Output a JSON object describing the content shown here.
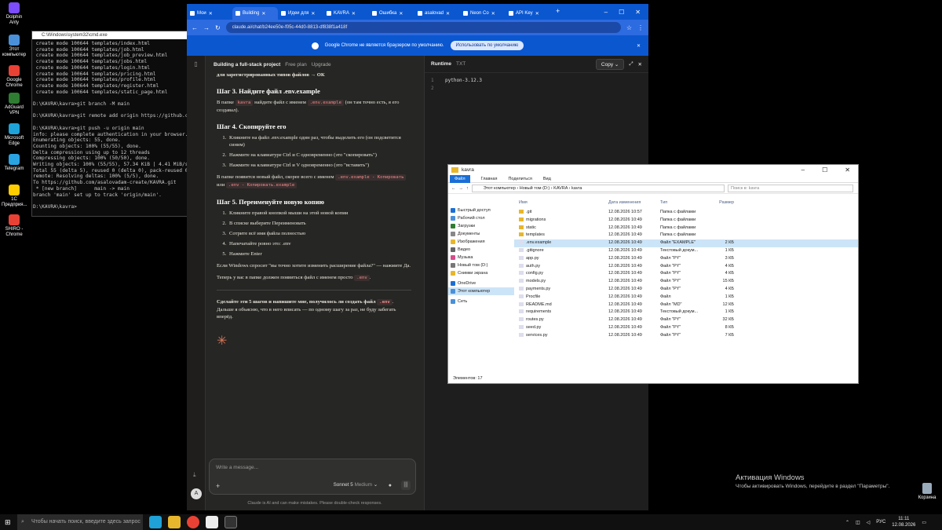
{
  "desktop": {
    "icons": [
      {
        "label": "Dolphin Anty",
        "color": "#7b4dff"
      },
      {
        "label": "Этот компьютер",
        "color": "#4a90d9"
      },
      {
        "label": "Google Chrome",
        "color": "#e94235"
      },
      {
        "label": "AdGuard VPN",
        "color": "#2e7d32"
      },
      {
        "label": "Microsoft Edge",
        "color": "#1fa2d8"
      },
      {
        "label": "Telegram",
        "color": "#2aa3e3"
      },
      {
        "label": "1С Предприя...",
        "color": "#ffcc00"
      },
      {
        "label": "SHIRO - Chrome",
        "color": "#e94235"
      }
    ],
    "recycle_bin": "Корзина"
  },
  "cmd": {
    "title": "C:\\Windows\\system32\\cmd.exe",
    "lines": [
      " create mode 100644 templates/index.html",
      " create mode 100644 templates/job.html",
      " create mode 100644 templates/job_preview.html",
      " create mode 100644 templates/jobs.html",
      " create mode 100644 templates/login.html",
      " create mode 100644 templates/pricing.html",
      " create mode 100644 templates/profile.html",
      " create mode 100644 templates/register.html",
      " create mode 100644 templates/static_page.html",
      "",
      "D:\\KAVRA\\kavra>git branch -M main",
      "",
      "D:\\KAVRA\\kavra>git remote add origin https://github.c",
      "",
      "D:\\KAVRA\\kavra>git push -u origin main",
      "info: please complete authentication in your browser.",
      "Enumerating objects: 55, done.",
      "Counting objects: 100% (55/55), done.",
      "Delta compression using up to 12 threads",
      "Compressing objects: 100% (50/50), done.",
      "Writing objects: 100% (55/55), 57.34 KiB | 4.41 MiB/s",
      "Total 55 (delta 5), reused 0 (delta 0), pack-reused 0",
      "remote: Resolving deltas: 100% (5/5), done.",
      "To https://github.com/asalovadam-create/KAVRA.git",
      " * [new branch]      main -> main",
      "branch 'main' set up to track 'origin/main'.",
      "",
      "D:\\KAVRA\\kavra>"
    ]
  },
  "chrome": {
    "tabs": [
      "Мои",
      "Building",
      "Идеи для",
      "KAVRA",
      "Ошибка",
      "asalovad",
      "Neon Co",
      "API Key"
    ],
    "url": "claude.ai/chat/b24ee50e-f05c-44d0-8813-df838f1a418f",
    "infobar_text": "Google Chrome не является браузером по умолчанию.",
    "infobar_button": "Использовать по умолчанию"
  },
  "claude": {
    "chat_title": "Building a full-stack project",
    "plan": "Free plan",
    "upgrade": "Upgrade",
    "top_cut": "для зарегистрированных типов файлов → ОК",
    "step3_title": "Шаг 3. Найдите файл .env.example",
    "step3_a": "В папке",
    "step3_code1": "kavra",
    "step3_b": "найдите файл с именем",
    "step3_code2": ".env.example",
    "step3_c": "(он там точно есть, я его создавал).",
    "step4_title": "Шаг 4. Скопируйте его",
    "step4_items": [
      "Кликните на файл .env.example один раз, чтобы выделить его (он подсветится синим)",
      "Нажмите на клавиатуре Ctrl и C одновременно (это \"скопировать\")",
      "Нажмите на клавиатуре Ctrl и V одновременно (это \"вставить\")"
    ],
    "step4_after": "В папке появится новый файл, скорее всего с именем",
    "step4_code1": ".env.example - Копировать",
    "step4_or": "или",
    "step4_code2": ".env - Копировать.example",
    "step5_title": "Шаг 5. Переименуйте новую копию",
    "step5_items": [
      "Кликните правой кнопкой мыши на этой новой копии",
      "В списке выберите Переименовать",
      "Сотрите всё имя файла полностью",
      "Напечатайте ровно это: .env",
      "Нажмите Enter"
    ],
    "step5_note": "Если Windows спросит \"вы точно хотите изменить расширение файла?\" — нажмите Да.",
    "step5_result_a": "Теперь у вас в папке должен появиться файл с именем просто",
    "step5_result_code": ".env",
    "final_a": "Сделайте эти 5 шагов и напишите мне, получилось ли создать файл",
    "final_code": ".env",
    "final_b": ". Дальше я объясню, что в него вписать — по одному шагу за раз, не буду забегать вперёд.",
    "placeholder": "Write a message...",
    "model": "Sonnet 5",
    "model_mode": "Medium",
    "disclaimer": "Claude is AI and can make mistakes. Please double-check responses.",
    "avatar": "A"
  },
  "artifact": {
    "title": "Runtime",
    "type": "TXT",
    "copy": "Copy",
    "lines": [
      "python-3.12.3",
      ""
    ]
  },
  "explorer": {
    "title": "kavra",
    "ribbon": [
      "Файл",
      "Главная",
      "Поделиться",
      "Вид"
    ],
    "path": [
      "Этот компьютер",
      "Новый том (D:)",
      "KAVRA",
      "kavra"
    ],
    "search_placeholder": "Поиск в: kavra",
    "nav": [
      "Быстрый доступ",
      "Рабочий стол",
      "Загрузки",
      "Документы",
      "Изображения",
      "Видео",
      "Музыка",
      "Новый том (D:)",
      "Снимки экрана",
      "OneDrive",
      "Этот компьютер",
      "Сеть"
    ],
    "columns": [
      "Имя",
      "Дата изменения",
      "Тип",
      "Размер"
    ],
    "files": [
      {
        "name": ".git",
        "date": "12.08.2026 10:57",
        "type": "Папка с файлами",
        "size": "",
        "folder": true
      },
      {
        "name": "migrations",
        "date": "12.08.2026 10:49",
        "type": "Папка с файлами",
        "size": "",
        "folder": true
      },
      {
        "name": "static",
        "date": "12.08.2026 10:49",
        "type": "Папка с файлами",
        "size": "",
        "folder": true
      },
      {
        "name": "templates",
        "date": "12.08.2026 10:49",
        "type": "Папка с файлами",
        "size": "",
        "folder": true
      },
      {
        "name": ".env.example",
        "date": "12.08.2026 10:49",
        "type": "Файл \"EXAMPLE\"",
        "size": "2 КБ",
        "folder": false
      },
      {
        "name": ".gitignore",
        "date": "12.08.2026 10:49",
        "type": "Текстовый докум...",
        "size": "1 КБ",
        "folder": false
      },
      {
        "name": "app.py",
        "date": "12.08.2026 10:49",
        "type": "Файл \"PY\"",
        "size": "3 КБ",
        "folder": false
      },
      {
        "name": "auth.py",
        "date": "12.08.2026 10:49",
        "type": "Файл \"PY\"",
        "size": "4 КБ",
        "folder": false
      },
      {
        "name": "config.py",
        "date": "12.08.2026 10:49",
        "type": "Файл \"PY\"",
        "size": "4 КБ",
        "folder": false
      },
      {
        "name": "models.py",
        "date": "12.08.2026 10:49",
        "type": "Файл \"PY\"",
        "size": "15 КБ",
        "folder": false
      },
      {
        "name": "payments.py",
        "date": "12.08.2026 10:49",
        "type": "Файл \"PY\"",
        "size": "4 КБ",
        "folder": false
      },
      {
        "name": "Procfile",
        "date": "12.08.2026 10:49",
        "type": "Файл",
        "size": "1 КБ",
        "folder": false
      },
      {
        "name": "README.md",
        "date": "12.08.2026 10:49",
        "type": "Файл \"MD\"",
        "size": "12 КБ",
        "folder": false
      },
      {
        "name": "requirements",
        "date": "12.08.2026 10:49",
        "type": "Текстовый докум...",
        "size": "1 КБ",
        "folder": false
      },
      {
        "name": "routes.py",
        "date": "12.08.2026 10:49",
        "type": "Файл \"PY\"",
        "size": "32 КБ",
        "folder": false
      },
      {
        "name": "seed.py",
        "date": "12.08.2026 10:49",
        "type": "Файл \"PY\"",
        "size": "8 КБ",
        "folder": false
      },
      {
        "name": "services.py",
        "date": "12.08.2026 10:49",
        "type": "Файл \"PY\"",
        "size": "7 КБ",
        "folder": false
      }
    ],
    "status": "Элементов: 17"
  },
  "watermark": {
    "title": "Активация Windows",
    "text": "Чтобы активировать Windows, перейдите в раздел \"Параметры\"."
  },
  "taskbar": {
    "search": "Чтобы начать поиск, введите здесь запрос",
    "lang": "РУС",
    "time": "11:11",
    "date": "12.08.2026"
  }
}
